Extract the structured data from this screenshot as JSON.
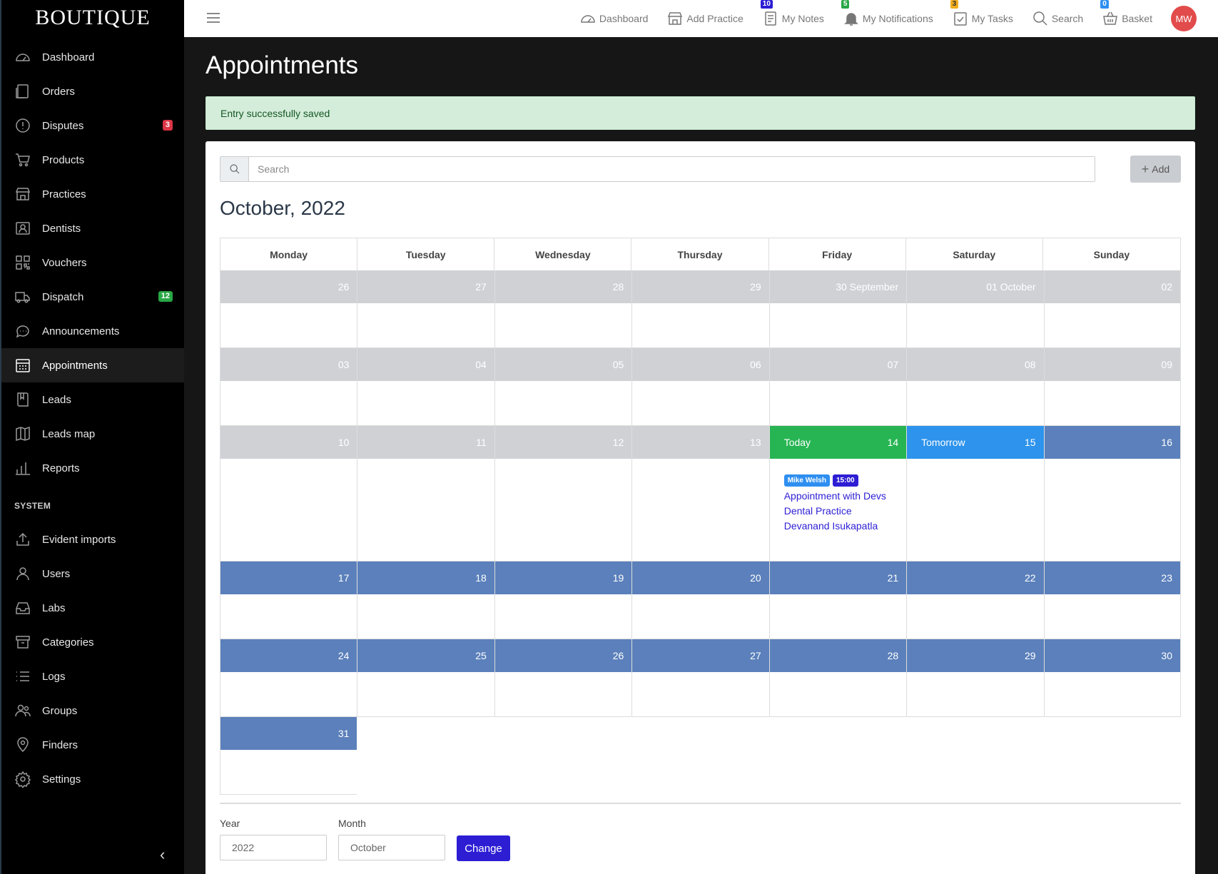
{
  "brand": "BOUTIQUE",
  "sidebar": {
    "items": [
      {
        "label": "Dashboard",
        "icon": "dashboard-icon"
      },
      {
        "label": "Orders",
        "icon": "orders-icon"
      },
      {
        "label": "Disputes",
        "icon": "alert-icon",
        "badge": "3"
      },
      {
        "label": "Products",
        "icon": "cart-icon"
      },
      {
        "label": "Practices",
        "icon": "store-icon"
      },
      {
        "label": "Dentists",
        "icon": "id-card-icon"
      },
      {
        "label": "Vouchers",
        "icon": "qr-code-icon"
      },
      {
        "label": "Dispatch",
        "icon": "truck-icon",
        "badge": "12"
      },
      {
        "label": "Announcements",
        "icon": "chat-icon"
      },
      {
        "label": "Appointments",
        "icon": "calendar-icon",
        "active": true
      },
      {
        "label": "Leads",
        "icon": "book-icon"
      },
      {
        "label": "Leads map",
        "icon": "map-icon"
      },
      {
        "label": "Reports",
        "icon": "bar-chart-icon"
      }
    ],
    "system_label": "SYSTEM",
    "system_items": [
      {
        "label": "Evident imports",
        "icon": "upload-icon"
      },
      {
        "label": "Users",
        "icon": "user-icon"
      },
      {
        "label": "Labs",
        "icon": "inbox-icon"
      },
      {
        "label": "Categories",
        "icon": "archive-icon"
      },
      {
        "label": "Logs",
        "icon": "list-icon"
      },
      {
        "label": "Groups",
        "icon": "users-icon"
      },
      {
        "label": "Finders",
        "icon": "map-pin-icon"
      },
      {
        "label": "Settings",
        "icon": "gear-icon"
      }
    ]
  },
  "topbar": {
    "dashboard": "Dashboard",
    "add_practice": "Add Practice",
    "my_notes": "My Notes",
    "my_notes_count": "10",
    "my_notifications": "My Notifications",
    "my_notifications_count": "5",
    "my_tasks": "My Tasks",
    "my_tasks_count": "3",
    "search": "Search",
    "basket": "Basket",
    "basket_count": "0",
    "avatar": "MW"
  },
  "page": {
    "title": "Appointments",
    "alert": "Entry successfully saved",
    "search_placeholder": "Search",
    "add_label": "Add",
    "month_title": "October, 2022"
  },
  "calendar": {
    "weekdays": [
      "Monday",
      "Tuesday",
      "Wednesday",
      "Thursday",
      "Friday",
      "Saturday",
      "Sunday"
    ],
    "weeks": [
      [
        {
          "n": "26",
          "s": "past"
        },
        {
          "n": "27",
          "s": "past"
        },
        {
          "n": "28",
          "s": "past"
        },
        {
          "n": "29",
          "s": "past"
        },
        {
          "n": "30 September",
          "s": "past"
        },
        {
          "n": "01 October",
          "s": "past"
        },
        {
          "n": "02",
          "s": "past"
        }
      ],
      [
        {
          "n": "03",
          "s": "past"
        },
        {
          "n": "04",
          "s": "past"
        },
        {
          "n": "05",
          "s": "past"
        },
        {
          "n": "06",
          "s": "past"
        },
        {
          "n": "07",
          "s": "past"
        },
        {
          "n": "08",
          "s": "past"
        },
        {
          "n": "09",
          "s": "past"
        }
      ],
      [
        {
          "n": "10",
          "s": "past"
        },
        {
          "n": "11",
          "s": "past"
        },
        {
          "n": "12",
          "s": "past"
        },
        {
          "n": "13",
          "s": "past"
        },
        {
          "n": "14",
          "s": "today",
          "label": "Today",
          "events": [
            {
              "person": "Mike Welsh",
              "time": "15:00",
              "lines": [
                "Appointment with Devs",
                "Dental Practice",
                "Devanand Isukapatla"
              ]
            }
          ]
        },
        {
          "n": "15",
          "s": "tomorrow",
          "label": "Tomorrow"
        },
        {
          "n": "16",
          "s": "future"
        }
      ],
      [
        {
          "n": "17",
          "s": "future"
        },
        {
          "n": "18",
          "s": "future"
        },
        {
          "n": "19",
          "s": "future"
        },
        {
          "n": "20",
          "s": "future"
        },
        {
          "n": "21",
          "s": "future"
        },
        {
          "n": "22",
          "s": "future"
        },
        {
          "n": "23",
          "s": "future"
        }
      ],
      [
        {
          "n": "24",
          "s": "future"
        },
        {
          "n": "25",
          "s": "future"
        },
        {
          "n": "26",
          "s": "future"
        },
        {
          "n": "27",
          "s": "future"
        },
        {
          "n": "28",
          "s": "future"
        },
        {
          "n": "29",
          "s": "future"
        },
        {
          "n": "30",
          "s": "future"
        }
      ],
      [
        {
          "n": "31",
          "s": "future"
        }
      ]
    ]
  },
  "form": {
    "year_label": "Year",
    "year_value": "2022",
    "month_label": "Month",
    "month_value": "October",
    "change_label": "Change"
  },
  "colors": {
    "today": "#27b553",
    "tomorrow": "#2d93ec",
    "future": "#5b80bb",
    "past": "#cfd1d5",
    "primary": "#2d1ed4"
  }
}
